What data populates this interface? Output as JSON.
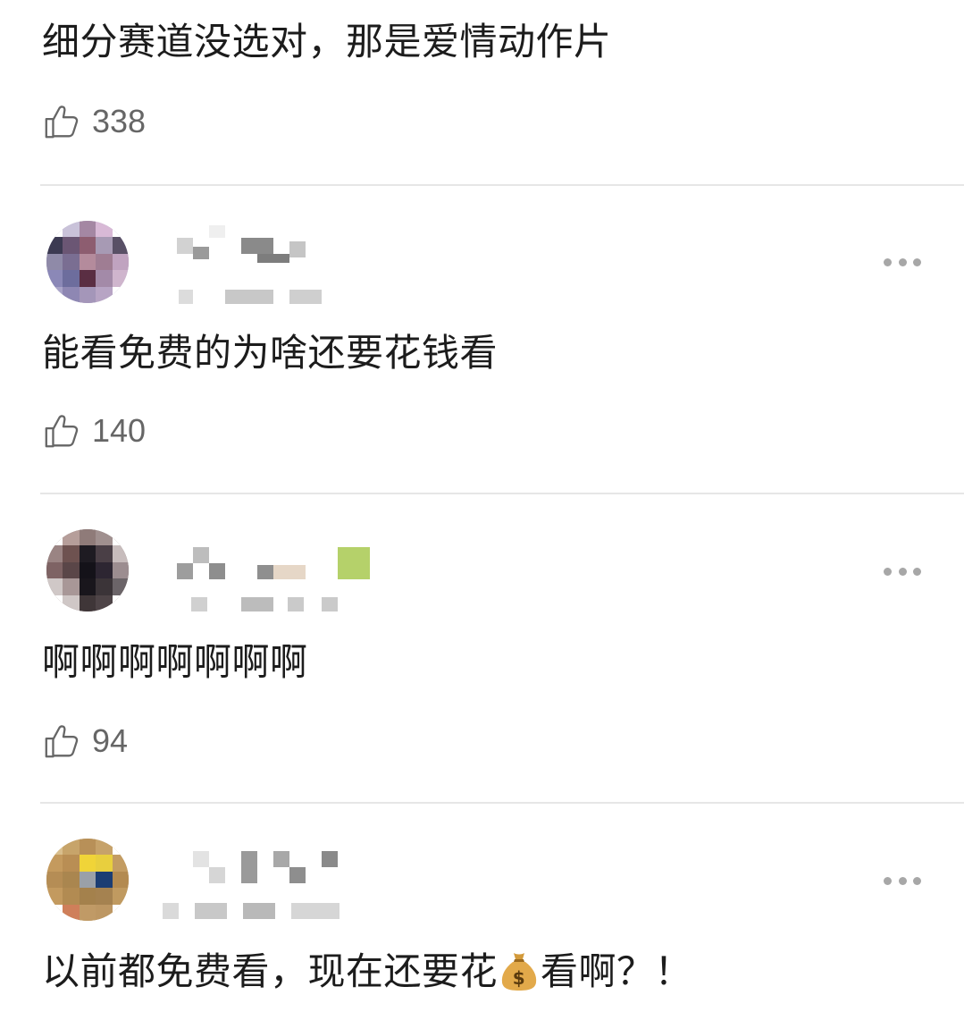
{
  "comments": [
    {
      "text": "细分赛道没选对，那是爱情动作片",
      "likes": "338"
    },
    {
      "text": "能看免费的为啥还要花钱看",
      "likes": "140"
    },
    {
      "text": "啊啊啊啊啊啊啊",
      "likes": "94"
    },
    {
      "text_before_emoji": "以前都免费看，现在还要花",
      "emoji": "money-bag-emoji",
      "text_after_emoji": "看啊？！"
    }
  ],
  "icons": {
    "like": "thumbs-up-icon",
    "more": "more-options-icon"
  },
  "colors": {
    "text": "#1c1c1c",
    "count": "#666666",
    "divider": "#e6e6e6",
    "more_dots": "#a7a7a7"
  }
}
